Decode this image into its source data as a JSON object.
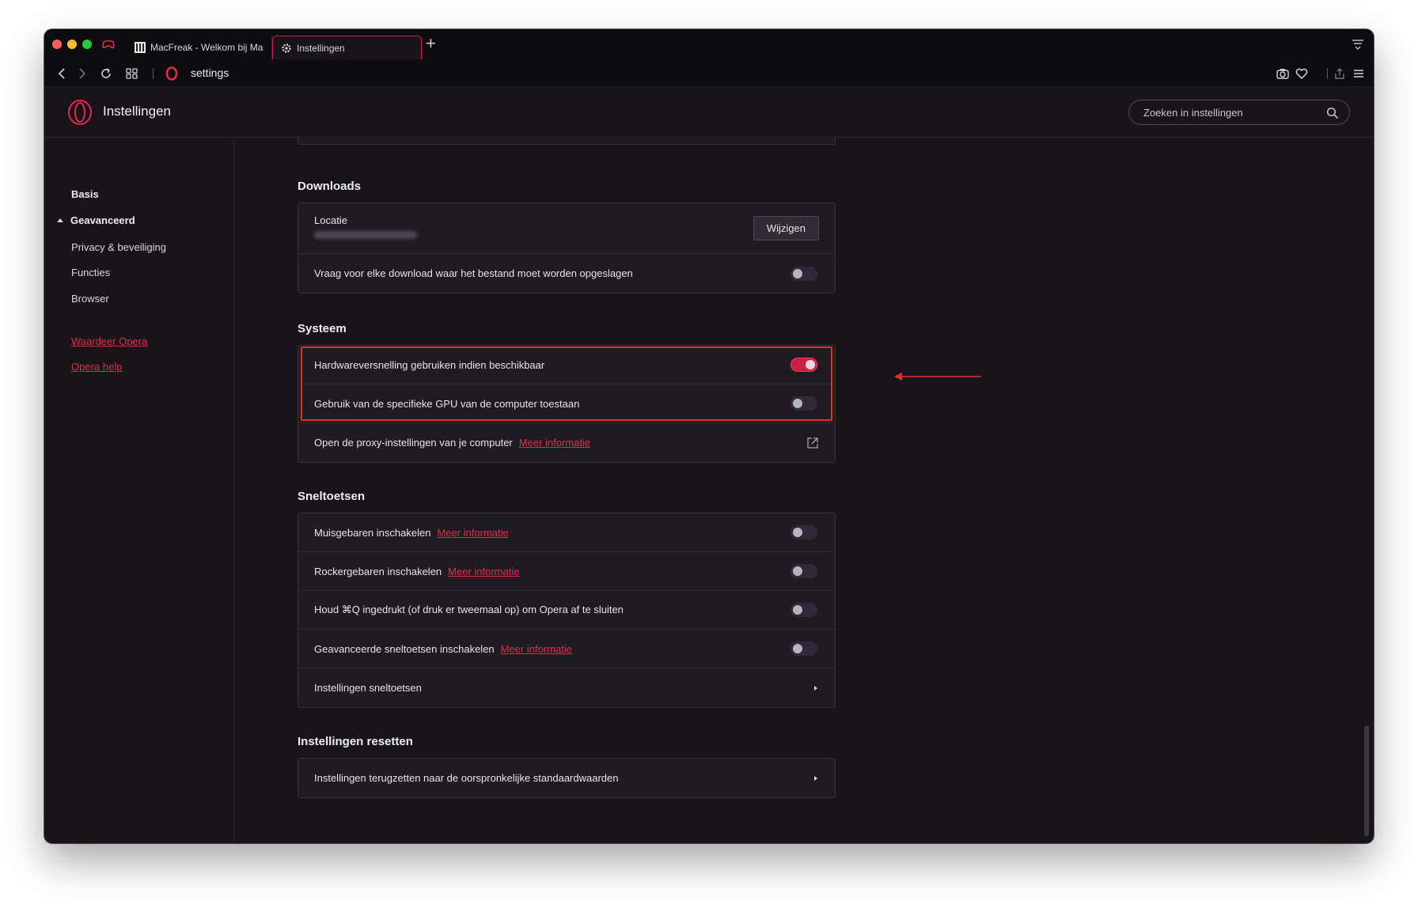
{
  "tabs": [
    {
      "title": "MacFreak - Welkom bij MacFr",
      "active": false
    },
    {
      "title": "Instellingen",
      "active": true
    }
  ],
  "address": {
    "url": "settings"
  },
  "header": {
    "title": "Instellingen",
    "search_placeholder": "Zoeken in instellingen"
  },
  "sidebar": {
    "items": [
      {
        "label": "Basis"
      },
      {
        "label": "Geavanceerd"
      },
      {
        "label": "Privacy & beveiliging"
      },
      {
        "label": "Functies"
      },
      {
        "label": "Browser"
      }
    ],
    "links": [
      {
        "label": "Waardeer Opera"
      },
      {
        "label": "Opera help"
      }
    ]
  },
  "downloads": {
    "title": "Downloads",
    "location_label": "Locatie",
    "change_button": "Wijzigen",
    "ask_label": "Vraag voor elke download waar het bestand moet worden opgeslagen",
    "ask_on": false
  },
  "system": {
    "title": "Systeem",
    "rows": [
      {
        "label": "Hardwareversnelling gebruiken indien beschikbaar",
        "on": true
      },
      {
        "label": "Gebruik van de specifieke GPU van de computer toestaan",
        "on": false
      }
    ],
    "proxy_label": "Open de proxy-instellingen van je computer",
    "proxy_link": "Meer informatie"
  },
  "shortcuts": {
    "title": "Sneltoetsen",
    "rows": [
      {
        "label": "Muisgebaren inschakelen",
        "link": "Meer informatie",
        "on": false
      },
      {
        "label": "Rockergebaren inschakelen",
        "link": "Meer informatie",
        "on": false
      },
      {
        "label": "Houd ⌘Q ingedrukt (of druk er tweemaal op) om Opera af te sluiten",
        "link": "",
        "on": false
      },
      {
        "label": "Geavanceerde sneltoetsen inschakelen",
        "link": "Meer informatie",
        "on": false
      }
    ],
    "settings_label": "Instellingen sneltoetsen"
  },
  "reset": {
    "title": "Instellingen resetten",
    "row_label": "Instellingen terugzetten naar de oorspronkelijke standaardwaarden"
  },
  "colors": {
    "accent": "#e12a4c",
    "highlight": "#e0321a",
    "background": "#17141a"
  }
}
